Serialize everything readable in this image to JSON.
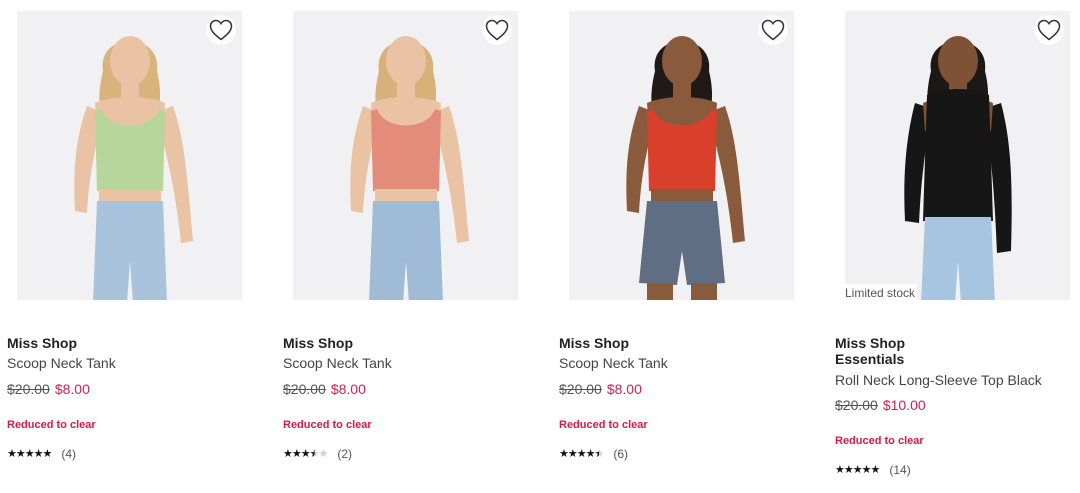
{
  "products": [
    {
      "brand": "Miss Shop",
      "title": "Scoop Neck Tank",
      "price_old": "$20.00",
      "price_new": "$8.00",
      "promo": "Reduced to clear",
      "rating": 5,
      "review_count": "(4)",
      "badge": "",
      "image": {
        "top_color": "#b7d69b",
        "bottom_color": "#a9c3dc",
        "hair_color": "#d9b37c",
        "skin_color": "#e9c3a4",
        "bottom_type": "jeans"
      }
    },
    {
      "brand": "Miss Shop",
      "title": "Scoop Neck Tank",
      "price_old": "$20.00",
      "price_new": "$8.00",
      "promo": "Reduced to clear",
      "rating": 3.5,
      "review_count": "(2)",
      "badge": "",
      "image": {
        "top_color": "#e48c7a",
        "bottom_color": "#9fbbd6",
        "hair_color": "#d8b07a",
        "skin_color": "#e9c3a4",
        "bottom_type": "jeans"
      }
    },
    {
      "brand": "Miss Shop",
      "title": "Scoop Neck Tank",
      "price_old": "$20.00",
      "price_new": "$8.00",
      "promo": "Reduced to clear",
      "rating": 4.5,
      "review_count": "(6)",
      "badge": "",
      "image": {
        "top_color": "#d9402c",
        "bottom_color": "#606e84",
        "hair_color": "#1f1a18",
        "skin_color": "#8a5a3c",
        "bottom_type": "shorts"
      }
    },
    {
      "brand": "Miss Shop Essentials",
      "title": "Roll Neck Long-Sleeve Top Black",
      "price_old": "$20.00",
      "price_new": "$10.00",
      "promo": "Reduced to clear",
      "rating": 5,
      "review_count": "(14)",
      "badge": "Limited stock",
      "image": {
        "top_color": "#161616",
        "bottom_color": "#a7c4e0",
        "hair_color": "#1c1816",
        "skin_color": "#7d5236",
        "bottom_type": "jeans"
      }
    }
  ],
  "icons": {
    "wishlist": "heart-outline-icon",
    "rating_star": "star-icon"
  },
  "colors": {
    "sale_price": "#cc2255",
    "promo_text": "#d21b47",
    "image_bg": "#f1f0f2"
  }
}
